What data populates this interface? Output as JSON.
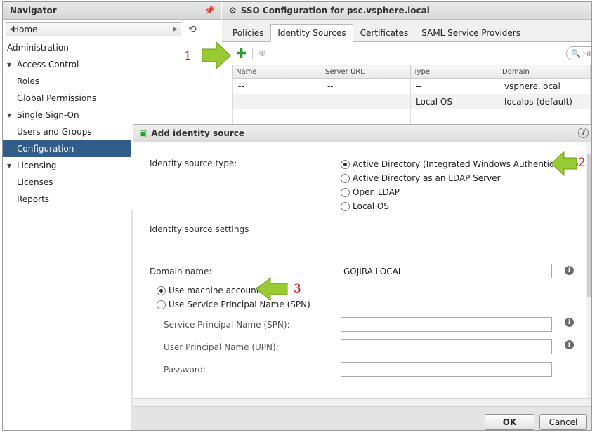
{
  "navigator": {
    "title": "Navigator",
    "home": "Home",
    "section": "Administration",
    "items": [
      {
        "label": "Access Control",
        "level": 1,
        "expanded": true
      },
      {
        "label": "Roles",
        "level": 2
      },
      {
        "label": "Global Permissions",
        "level": 2
      },
      {
        "label": "Single Sign-On",
        "level": 1,
        "expanded": true
      },
      {
        "label": "Users and Groups",
        "level": 2
      },
      {
        "label": "Configuration",
        "level": 2,
        "selected": true
      },
      {
        "label": "Licensing",
        "level": 1,
        "expanded": true
      },
      {
        "label": "Licenses",
        "level": 2
      },
      {
        "label": "Reports",
        "level": 2
      }
    ]
  },
  "panel": {
    "title": "SSO Configuration for psc.vsphere.local",
    "tabs": [
      "Policies",
      "Identity Sources",
      "Certificates",
      "SAML Service Providers"
    ],
    "active_tab": "Identity Sources",
    "filter_placeholder": "Filt",
    "table": {
      "columns": [
        "Name",
        "Server URL",
        "Type",
        "Domain"
      ],
      "rows": [
        [
          "--",
          "--",
          "--",
          "vsphere.local"
        ],
        [
          "--",
          "--",
          "Local OS",
          "localos (default)"
        ],
        [
          "",
          "",
          "",
          ""
        ]
      ]
    }
  },
  "dialog": {
    "title": "Add identity source",
    "help": "?",
    "type_label": "Identity source type:",
    "type_options": [
      {
        "label": "Active Directory (Integrated Windows Authentication)",
        "selected": true
      },
      {
        "label": "Active Directory as an LDAP Server",
        "selected": false
      },
      {
        "label": "Open LDAP",
        "selected": false
      },
      {
        "label": "Local OS",
        "selected": false
      }
    ],
    "settings_label": "Identity source settings",
    "domain_label": "Domain name:",
    "domain_value": "GOJIRA.LOCAL",
    "auth_options": [
      {
        "label": "Use machine account",
        "selected": true
      },
      {
        "label": "Use Service Principal Name (SPN)",
        "selected": false
      }
    ],
    "spn_label": "Service Principal Name (SPN):",
    "upn_label": "User Principal Name (UPN):",
    "password_label": "Password:",
    "ok": "OK",
    "cancel": "Cancel"
  },
  "annotations": [
    "1",
    "2",
    "3"
  ],
  "colors": {
    "selected_nav": "#315d8a",
    "arrow": "#99cc33",
    "annotation": "#cc1111",
    "add_icon": "#2c9a2c"
  }
}
